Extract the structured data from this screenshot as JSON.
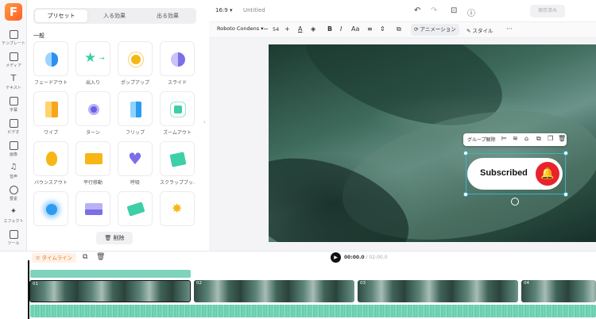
{
  "app": {
    "logo": "F"
  },
  "rail": [
    {
      "label": "テンプレート",
      "icon": "template-icon"
    },
    {
      "label": "メディア",
      "icon": "media-icon"
    },
    {
      "label": "テキスト",
      "icon": "text-icon"
    },
    {
      "label": "字幕",
      "icon": "subtitle-icon"
    },
    {
      "label": "ビデオ",
      "icon": "video-icon"
    },
    {
      "label": "画像",
      "icon": "image-icon"
    },
    {
      "label": "音声",
      "icon": "audio-icon"
    },
    {
      "label": "要素",
      "icon": "element-icon"
    },
    {
      "label": "エフェクト",
      "icon": "effect-icon"
    },
    {
      "label": "ツール",
      "icon": "tool-icon"
    }
  ],
  "panel": {
    "tabs": [
      "プリセット",
      "入る効果",
      "出る効果"
    ],
    "section": "一般",
    "delete_label": "削除",
    "presets": [
      "フェードアウト",
      "出入り",
      "ポップアップ",
      "スライド",
      "ワイプ",
      "ターン",
      "フリップ",
      "ズームアウト",
      "バウンスアウト",
      "平行移動",
      "呼吸",
      "スクラップブッ...",
      "",
      "",
      "",
      ""
    ]
  },
  "topbar": {
    "ratio": "16:9 ▾",
    "title": "Untitled",
    "save_label": "保存済み"
  },
  "format": {
    "font": "Roboto Condens ▾",
    "minus": "−",
    "size": "54",
    "plus": "+",
    "animation_label": "アニメーション",
    "style_label": "スタイル",
    "more": "···"
  },
  "selection": {
    "ungroup_label": "グループ解除"
  },
  "sticker": {
    "text": "Subscribed",
    "bell": "🔔"
  },
  "timeline": {
    "label": "タイムライン",
    "current": "00:00.0",
    "total": "/ 02:00.0",
    "clips": [
      "01",
      "02",
      "03",
      "04"
    ]
  },
  "colors": {
    "accent": "#3bb3c3",
    "brand": "#ff6a2b",
    "bell": "#e8232b",
    "track": "#5cc8a6"
  }
}
